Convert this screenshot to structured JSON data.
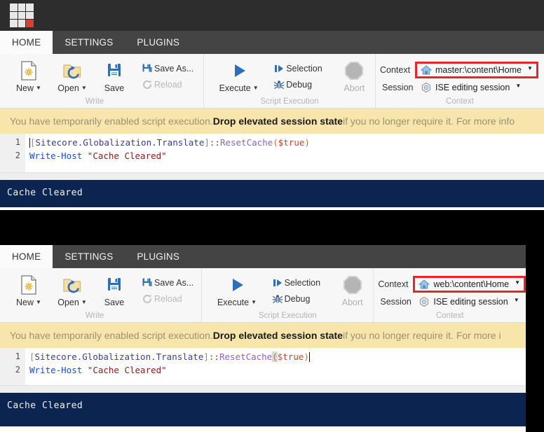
{
  "app": {
    "logo_name": "sitecore-logo",
    "logo_accent_color": "#d8412f"
  },
  "panels": [
    {
      "id": "panel-top",
      "tabs": [
        {
          "label": "HOME",
          "active": true
        },
        {
          "label": "SETTINGS",
          "active": false
        },
        {
          "label": "PLUGINS",
          "active": false
        }
      ],
      "groups": {
        "write": {
          "label": "Write",
          "new_label": "New",
          "open_label": "Open",
          "save_label": "Save",
          "save_as_label": "Save As...",
          "reload_label": "Reload"
        },
        "script_execution": {
          "label": "Script Execution",
          "execute_label": "Execute",
          "selection_label": "Selection",
          "debug_label": "Debug",
          "abort_label": "Abort"
        },
        "context": {
          "label": "Context",
          "context_key": "Context",
          "context_value": "master:\\content\\Home",
          "session_key": "Session",
          "session_value": "ISE editing session"
        }
      },
      "warning": {
        "prefix": "You have temporarily enabled script execution. ",
        "link": "Drop elevated session state",
        "suffix": " if you no longer require it. For more info"
      },
      "editor": {
        "lines": [
          {
            "num": "1",
            "cursor_at_start": true,
            "tokens": [
              {
                "t": "[",
                "c": "t-brk"
              },
              {
                "t": "Sitecore.Globalization.Translate",
                "c": "t-type"
              },
              {
                "t": "]",
                "c": "t-brk"
              },
              {
                "t": "::",
                "c": "t-dot"
              },
              {
                "t": "ResetCache",
                "c": "t-mem"
              },
              {
                "t": "(",
                "c": "t-par"
              },
              {
                "t": "$true",
                "c": "t-var"
              },
              {
                "t": ")",
                "c": "t-par"
              }
            ]
          },
          {
            "num": "2",
            "tokens": [
              {
                "t": "Write-Host",
                "c": "t-cmd"
              },
              {
                "t": " ",
                "c": "t-plain"
              },
              {
                "t": "\"Cache Cleared\"",
                "c": "t-str"
              }
            ]
          }
        ]
      },
      "console": {
        "text": "Cache Cleared"
      }
    },
    {
      "id": "panel-bottom",
      "tabs": [
        {
          "label": "HOME",
          "active": true
        },
        {
          "label": "SETTINGS",
          "active": false
        },
        {
          "label": "PLUGINS",
          "active": false
        }
      ],
      "groups": {
        "write": {
          "label": "Write",
          "new_label": "New",
          "open_label": "Open",
          "save_label": "Save",
          "save_as_label": "Save As...",
          "reload_label": "Reload"
        },
        "script_execution": {
          "label": "Script Execution",
          "execute_label": "Execute",
          "selection_label": "Selection",
          "debug_label": "Debug",
          "abort_label": "Abort"
        },
        "context": {
          "label": "Context",
          "context_key": "Context",
          "context_value": "web:\\content\\Home",
          "session_key": "Session",
          "session_value": "ISE editing session"
        }
      },
      "warning": {
        "prefix": "You have temporarily enabled script execution. ",
        "link": "Drop elevated session state",
        "suffix": " if you no longer require it. For more i"
      },
      "editor": {
        "lines": [
          {
            "num": "1",
            "bracket_highlight": true,
            "cursor_at_end": true,
            "tokens": [
              {
                "t": "[",
                "c": "t-brk"
              },
              {
                "t": "Sitecore.Globalization.Translate",
                "c": "t-type"
              },
              {
                "t": "]",
                "c": "t-brk"
              },
              {
                "t": "::",
                "c": "t-dot"
              },
              {
                "t": "ResetCache",
                "c": "t-mem"
              },
              {
                "t": "(",
                "c": "t-par brk-hl"
              },
              {
                "t": "$true",
                "c": "t-var"
              },
              {
                "t": ")",
                "c": "t-par"
              }
            ]
          },
          {
            "num": "2",
            "tokens": [
              {
                "t": "Write-Host",
                "c": "t-cmd"
              },
              {
                "t": " ",
                "c": "t-plain"
              },
              {
                "t": "\"Cache Cleared\"",
                "c": "t-str"
              }
            ]
          }
        ]
      },
      "console": {
        "text": "Cache Cleared"
      }
    }
  ],
  "icons": {
    "new": "new-file-icon",
    "open": "open-folder-icon",
    "save": "floppy-save-icon",
    "save_as": "floppy-save-as-icon",
    "reload": "reload-icon",
    "execute": "play-triangle-icon",
    "selection": "selection-play-icon",
    "debug": "bug-icon",
    "abort": "octagon-stop-icon",
    "context": "home-icon",
    "session": "target-icon",
    "caret": "chevron-down-icon"
  }
}
